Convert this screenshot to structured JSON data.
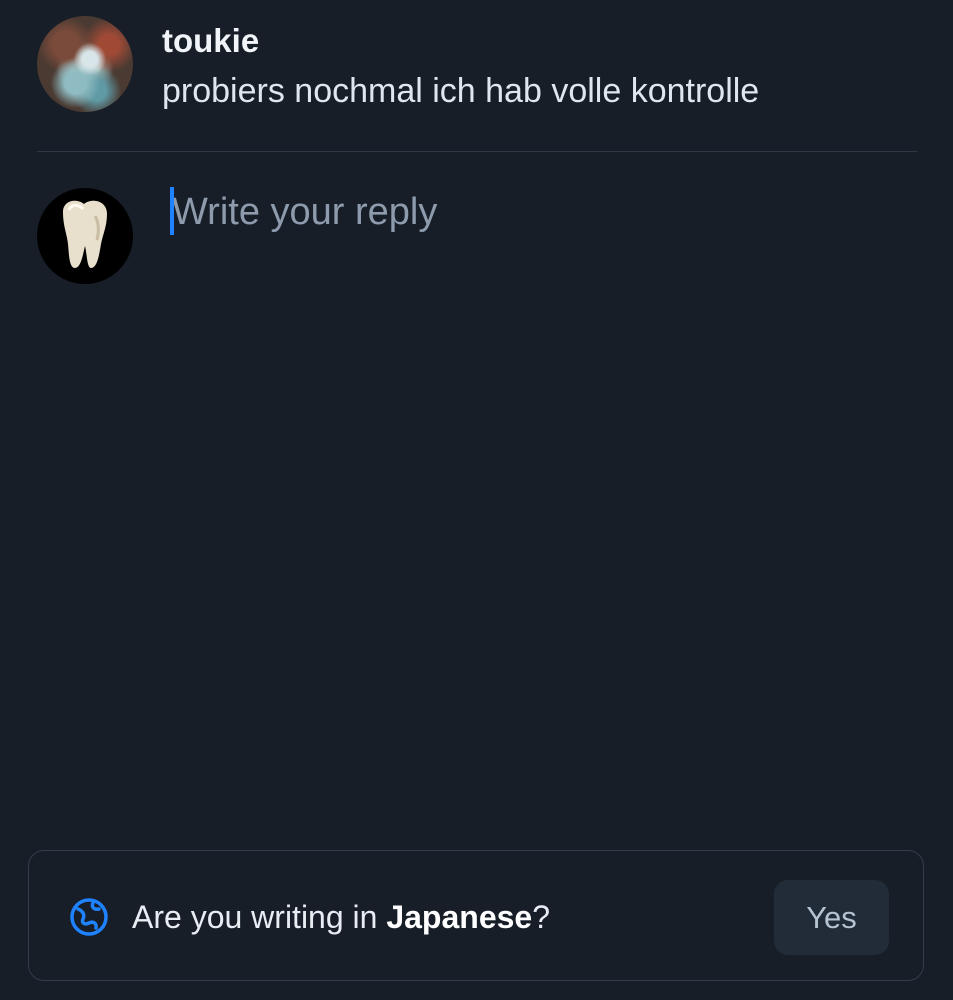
{
  "parent_post": {
    "author": "toukie",
    "text": "probiers nochmal ich hab volle kontrolle"
  },
  "reply": {
    "placeholder": "Write your reply",
    "value": ""
  },
  "language_prompt": {
    "icon": "language-globe-icon",
    "prefix": "Are you writing in ",
    "language": "Japanese",
    "suffix": "?",
    "yes_label": "Yes"
  },
  "colors": {
    "background": "#171e28",
    "accent": "#1f83ff",
    "placeholder": "#8d9bad",
    "divider": "#2e3744"
  }
}
